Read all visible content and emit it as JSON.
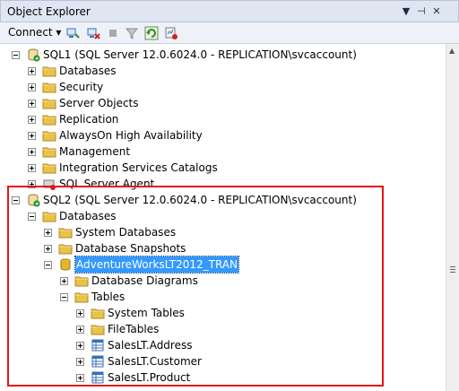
{
  "window": {
    "title": "Object Explorer",
    "controls": [
      "▼",
      "⊣",
      "✕"
    ]
  },
  "toolbar": {
    "connect_label": "Connect ▾"
  },
  "tree": [
    {
      "label": "SQL1 (SQL Server 12.0.6024.0 - REPLICATION\\svcaccount)",
      "icon": "server-icon",
      "expander": "minus",
      "level": 0
    },
    {
      "label": "Databases",
      "icon": "folder-icon",
      "expander": "plus",
      "level": 1
    },
    {
      "label": "Security",
      "icon": "folder-icon",
      "expander": "plus",
      "level": 1
    },
    {
      "label": "Server Objects",
      "icon": "folder-icon",
      "expander": "plus",
      "level": 1
    },
    {
      "label": "Replication",
      "icon": "folder-icon",
      "expander": "plus",
      "level": 1
    },
    {
      "label": "AlwaysOn High Availability",
      "icon": "folder-icon",
      "expander": "plus",
      "level": 1
    },
    {
      "label": "Management",
      "icon": "folder-icon",
      "expander": "plus",
      "level": 1
    },
    {
      "label": "Integration Services Catalogs",
      "icon": "folder-icon",
      "expander": "plus",
      "level": 1
    },
    {
      "label": "SQL Server Agent",
      "icon": "agent-icon",
      "expander": "plus",
      "level": 1
    },
    {
      "label": "SQL2 (SQL Server 12.0.6024.0 - REPLICATION\\svcaccount)",
      "icon": "server-icon",
      "expander": "minus",
      "level": 0
    },
    {
      "label": "Databases",
      "icon": "folder-icon",
      "expander": "minus",
      "level": 1
    },
    {
      "label": "System Databases",
      "icon": "folder-icon",
      "expander": "plus",
      "level": 2
    },
    {
      "label": "Database Snapshots",
      "icon": "folder-icon",
      "expander": "plus",
      "level": 2
    },
    {
      "label": "AdventureWorksLT2012_TRAN",
      "icon": "database-icon",
      "expander": "minus",
      "level": 2,
      "selected": true
    },
    {
      "label": "Database Diagrams",
      "icon": "folder-icon",
      "expander": "plus",
      "level": 3
    },
    {
      "label": "Tables",
      "icon": "folder-icon",
      "expander": "minus",
      "level": 3
    },
    {
      "label": "System Tables",
      "icon": "folder-icon",
      "expander": "plus",
      "level": 4
    },
    {
      "label": "FileTables",
      "icon": "folder-icon",
      "expander": "plus",
      "level": 4
    },
    {
      "label": "SalesLT.Address",
      "icon": "table-icon",
      "expander": "plus",
      "level": 4
    },
    {
      "label": "SalesLT.Customer",
      "icon": "table-icon",
      "expander": "plus",
      "level": 4
    },
    {
      "label": "SalesLT.Product",
      "icon": "table-icon",
      "expander": "plus",
      "level": 4
    }
  ],
  "colors": {
    "highlight_box": "#e4141c",
    "selection": "#3399ff",
    "folder": "#e8c24a"
  }
}
